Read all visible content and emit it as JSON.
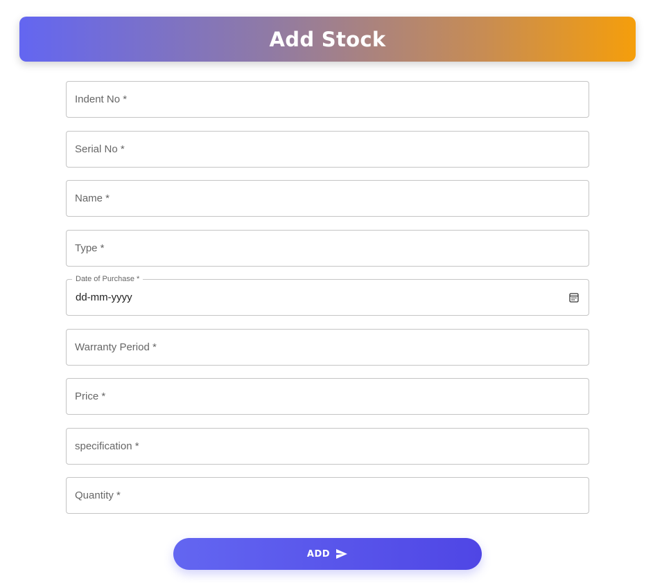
{
  "header": {
    "title": "Add Stock"
  },
  "form": {
    "fields": [
      {
        "label": "Indent No *"
      },
      {
        "label": "Serial No *"
      },
      {
        "label": "Name *"
      },
      {
        "label": "Type *"
      }
    ],
    "date_field": {
      "label": "Date of Purchase *",
      "value": "dd-mm-yyyy",
      "icon": "calendar-icon"
    },
    "fields_after": [
      {
        "label": "Warranty Period *"
      },
      {
        "label": "Price *"
      },
      {
        "label": "specification *"
      },
      {
        "label": "Quantity *"
      }
    ]
  },
  "submit": {
    "label": "ADD",
    "icon": "send-icon"
  },
  "colors": {
    "header_gradient_start": "#6366f1",
    "header_gradient_end": "#f59e0b",
    "button_gradient_start": "#6366f1",
    "button_gradient_end": "#4f46e5",
    "field_border": "#c4c4c4",
    "label_text": "#666666"
  }
}
